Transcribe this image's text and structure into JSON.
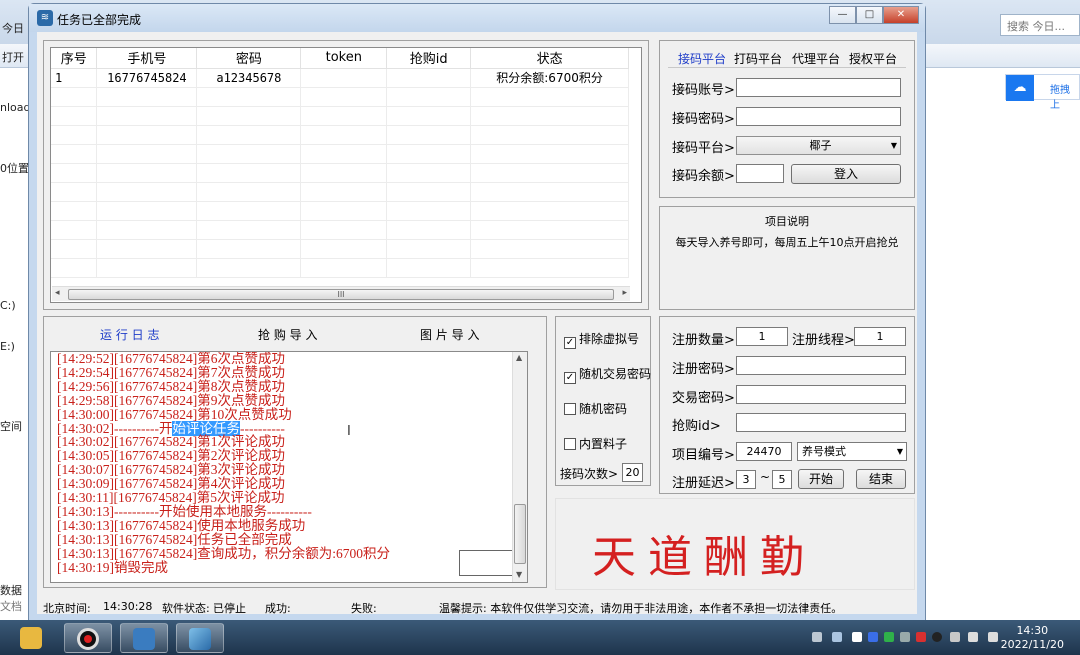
{
  "background": {
    "left_labels": [
      "今日",
      "打开",
      "nloads",
      "0位置",
      "C:)",
      "E:)",
      "空间",
      "数据",
      "文档"
    ],
    "search_placeholder": "搜索 今日...",
    "baidu_text": "拖拽上"
  },
  "window": {
    "title": "任务已全部完成",
    "min": "—",
    "max": "□",
    "close": "✕"
  },
  "table": {
    "columns": [
      "序号",
      "手机号",
      "密码",
      "token",
      "抢购id",
      "状态"
    ],
    "rows": [
      [
        "1",
        "16776745824",
        "a12345678",
        "",
        "",
        "积分余额:6700积分"
      ]
    ],
    "scroll_mark": "III"
  },
  "platform": {
    "tabs": [
      "接码平台",
      "打码平台",
      "代理平台",
      "授权平台"
    ],
    "account_label": "接码账号>",
    "password_label": "接码密码>",
    "platform_label": "接码平台>",
    "platform_value": "椰子",
    "balance_label": "接码余额>",
    "login_button": "登入"
  },
  "project": {
    "title": "项目说明",
    "desc": "每天导入养号即可，每周五上午10点开启抢兑"
  },
  "log_tabs": [
    "运 行 日 志",
    "抢 购 导 入",
    "图 片 导 入"
  ],
  "log": {
    "lines": [
      "[14:29:52][16776745824]第6次点赞成功",
      "[14:29:54][16776745824]第7次点赞成功",
      "[14:29:56][16776745824]第8次点赞成功",
      "[14:29:58][16776745824]第9次点赞成功",
      "[14:30:00][16776745824]第10次点赞成功",
      "[14:30:02]----------开始评论任务----------",
      "[14:30:02][16776745824]第1次评论成功",
      "[14:30:05][16776745824]第2次评论成功",
      "[14:30:07][16776745824]第3次评论成功",
      "[14:30:09][16776745824]第4次评论成功",
      "[14:30:11][16776745824]第5次评论成功",
      "[14:30:13]----------开始使用本地服务----------",
      "[14:30:13][16776745824]使用本地服务成功",
      "[14:30:13][16776745824]任务已全部完成",
      "[14:30:13][16776745824]查询成功，积分余额为:6700积分",
      "[14:30:19]销毁完成"
    ]
  },
  "options": {
    "exclude_virtual": "排除虚拟号",
    "random_trade_pwd": "随机交易密码",
    "random_pwd": "随机密码",
    "builtin": "内置料子",
    "code_times_label": "接码次数>",
    "code_times_value": "20"
  },
  "register": {
    "count_label": "注册数量>",
    "count_value": "1",
    "threads_label": "注册线程>",
    "threads_value": "1",
    "pwd_label": "注册密码>",
    "trade_pwd_label": "交易密码>",
    "buy_id_label": "抢购id>",
    "project_no_label": "项目编号>",
    "project_no_value": "24470",
    "mode_value": "养号模式",
    "delay_label": "注册延迟>",
    "delay_min": "3",
    "delay_sep": "~",
    "delay_max": "5",
    "start_button": "开始",
    "end_button": "结束"
  },
  "brand": "天道酬勤",
  "status": {
    "time_label": "北京时间:",
    "time_value": "14:30:28",
    "software_label": "软件状态:",
    "software_value": "已停止",
    "success_label": "成功:",
    "fail_label": "失败:",
    "tip": "温馨提示: 本软件仅供学习交流，请勿用于非法用途，本作者不承担一切法律责任。"
  },
  "clock": {
    "time": "14:30",
    "date": "2022/11/20"
  },
  "colors": {
    "log_red": "#c8201a",
    "brand_red": "#d42020",
    "tab_blue": "#1e3cc8"
  }
}
